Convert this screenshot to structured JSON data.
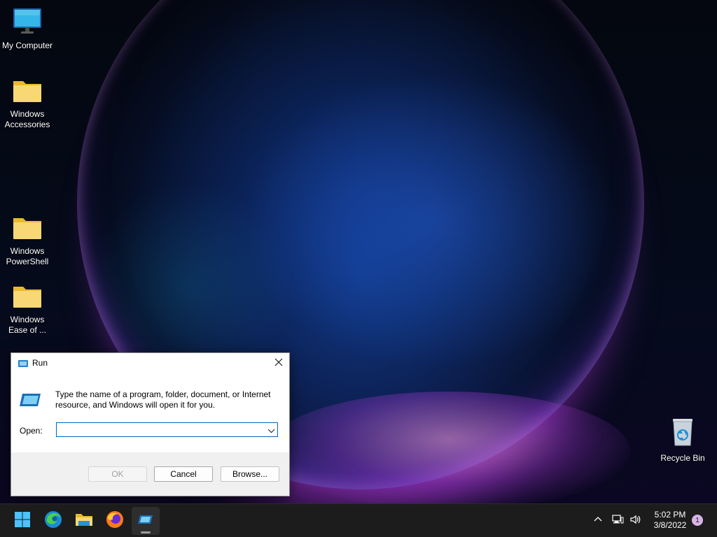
{
  "desktop": {
    "icons": [
      {
        "label": "My Computer"
      },
      {
        "label": "Windows Accessories"
      },
      {
        "label": "Windows PowerShell"
      },
      {
        "label": "Windows Ease of ..."
      },
      {
        "label": "Recycle Bin"
      }
    ]
  },
  "run_dialog": {
    "title": "Run",
    "description": "Type the name of a program, folder, document, or Internet resource, and Windows will open it for you.",
    "open_label": "Open:",
    "open_value": "",
    "buttons": {
      "ok": "OK",
      "cancel": "Cancel",
      "browse": "Browse..."
    }
  },
  "taskbar": {
    "apps": [
      "start-button",
      "edge-browser",
      "file-explorer",
      "firefox-browser",
      "run-app"
    ],
    "clock_time": "5:02 PM",
    "clock_date": "3/8/2022",
    "notification_count": "1"
  },
  "colors": {
    "accent": "#0067c0",
    "taskbar": "#1c1c1c",
    "folder": "#f8d775"
  }
}
